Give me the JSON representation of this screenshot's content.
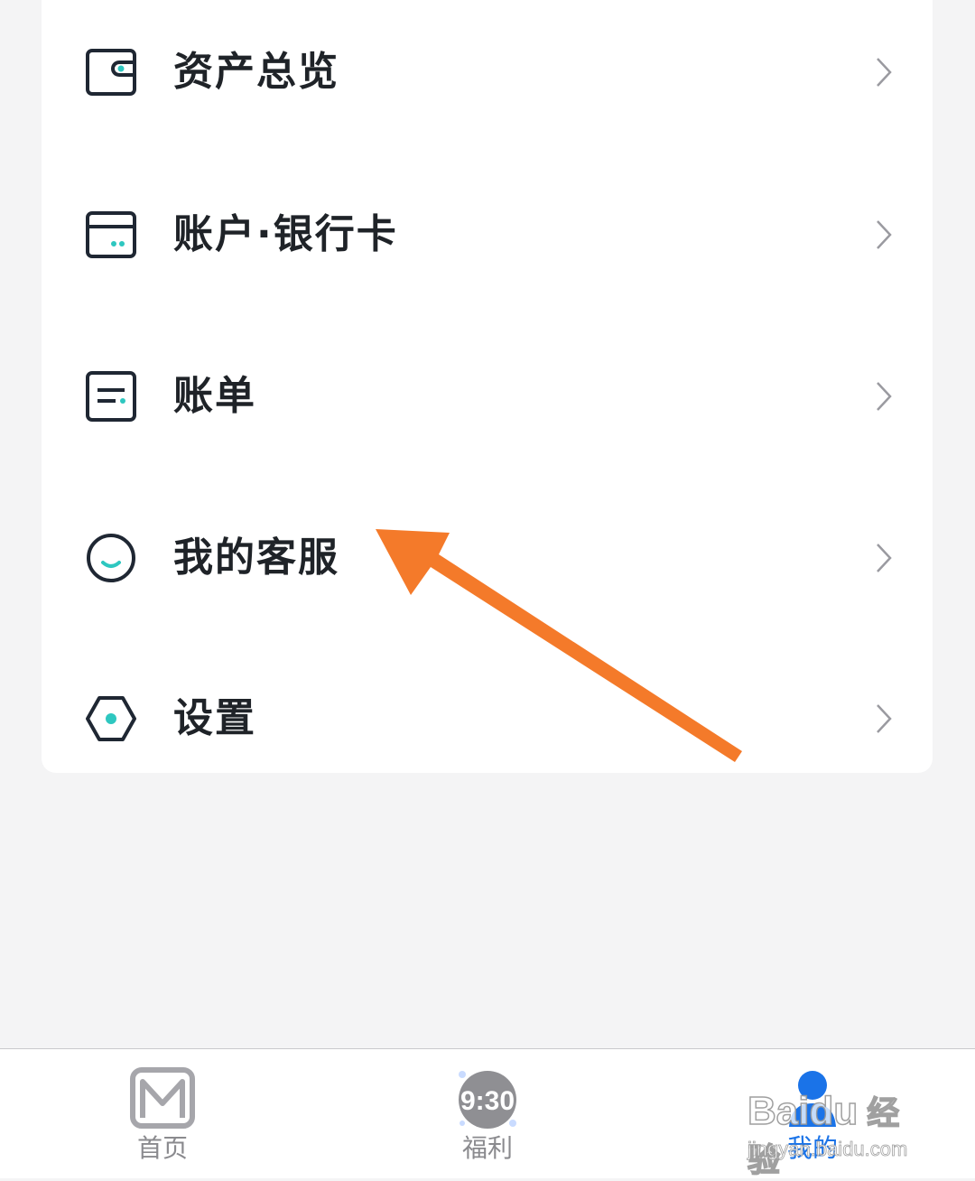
{
  "menu": {
    "items": [
      {
        "label": "资产总览",
        "icon": "wallet-icon"
      },
      {
        "label": "账户·银行卡",
        "icon": "bank-card-icon"
      },
      {
        "label": "账单",
        "icon": "bill-icon"
      },
      {
        "label": "我的客服",
        "icon": "customer-service-icon"
      },
      {
        "label": "设置",
        "icon": "settings-icon"
      }
    ]
  },
  "tabbar": {
    "tabs": [
      {
        "label": "首页",
        "icon": "home-logo-icon"
      },
      {
        "label": "福利",
        "icon": "welfare-930-icon",
        "badge": "9:30"
      },
      {
        "label": "我的",
        "icon": "profile-icon",
        "active": true
      }
    ]
  },
  "watermark": {
    "brand": "Bai",
    "brand2": "du",
    "cn": "经验",
    "sub": "jingyan.baidu.com"
  },
  "colors": {
    "accent": "#1a73e8",
    "teal": "#2ec7c0",
    "arrow": "#f47a2a",
    "icon_dark": "#1f2733"
  }
}
